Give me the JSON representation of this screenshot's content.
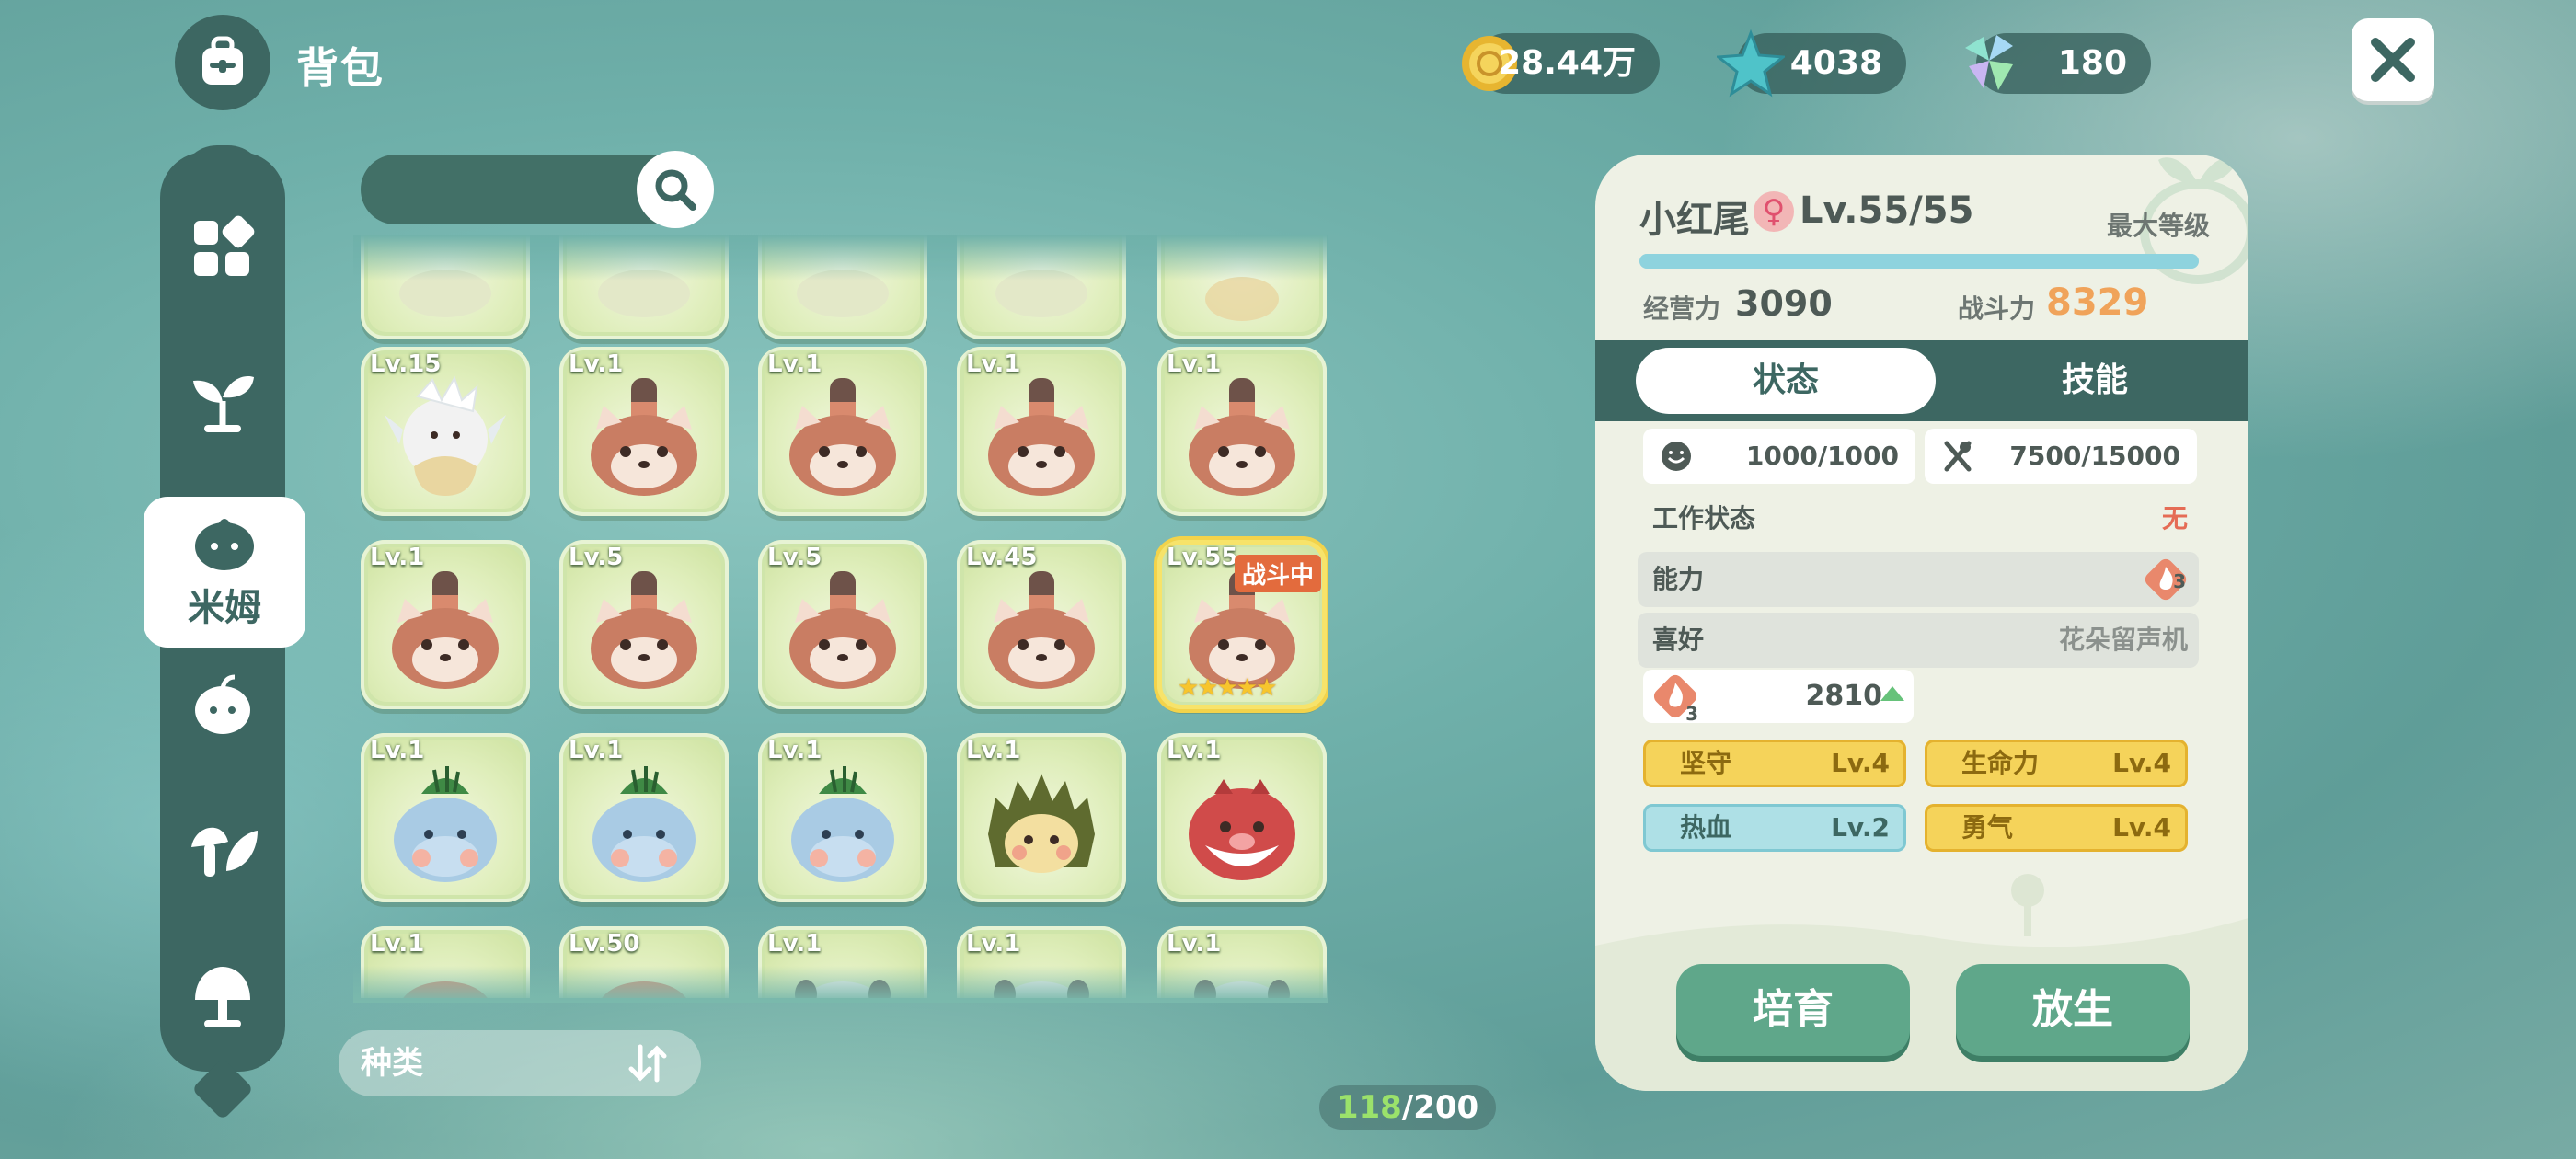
{
  "header": {
    "title": "背包"
  },
  "currency": {
    "coins": "28.44万",
    "stars": "4038",
    "gems": "180"
  },
  "sidebar": {
    "active_label": "米姆"
  },
  "search": {
    "placeholder": ""
  },
  "grid": {
    "top_row": [
      "",
      "",
      "",
      "",
      ""
    ],
    "row1": [
      "Lv.15",
      "Lv.1",
      "Lv.1",
      "Lv.1",
      "Lv.1"
    ],
    "row2": [
      "Lv.1",
      "Lv.5",
      "Lv.5",
      "Lv.45",
      "Lv.55"
    ],
    "row3": [
      "Lv.1",
      "Lv.1",
      "Lv.1",
      "Lv.1",
      "Lv.1"
    ],
    "row4": [
      "Lv.1",
      "Lv.50",
      "Lv.1",
      "Lv.1",
      "Lv.1"
    ],
    "battle_tag": "战斗中",
    "active_stars": 5
  },
  "sort": {
    "label": "种类"
  },
  "capacity": {
    "current": "118",
    "sep": "/200"
  },
  "detail": {
    "name": "小红尾",
    "sex": "♀",
    "level": "Lv.55/55",
    "max_label": "最大等级",
    "level_fill": 1.0,
    "manage_label": "经营力",
    "manage_value": "3090",
    "combat_label": "战斗力",
    "combat_value": "8329",
    "tab_status": "状态",
    "tab_skill": "技能",
    "mood": "1000/1000",
    "food": "7500/15000",
    "work_label": "工作状态",
    "work_value": "无",
    "ability_label": "能力",
    "ability_badge": "3",
    "hobby_label": "喜好",
    "hobby_value": "花朵留声机",
    "power_badge": "3",
    "power_value": "2810",
    "traits": [
      {
        "name": "坚守",
        "level": "Lv.4"
      },
      {
        "name": "生命力",
        "level": "Lv.4"
      },
      {
        "name": "热血",
        "level": "Lv.2"
      },
      {
        "name": "勇气",
        "level": "Lv.4"
      }
    ],
    "btn_breed": "培育",
    "btn_release": "放生"
  },
  "colors": {
    "accent_dark": "#3d6762",
    "combat_orange": "#f0a35a",
    "button_green": "#5fa78a"
  }
}
